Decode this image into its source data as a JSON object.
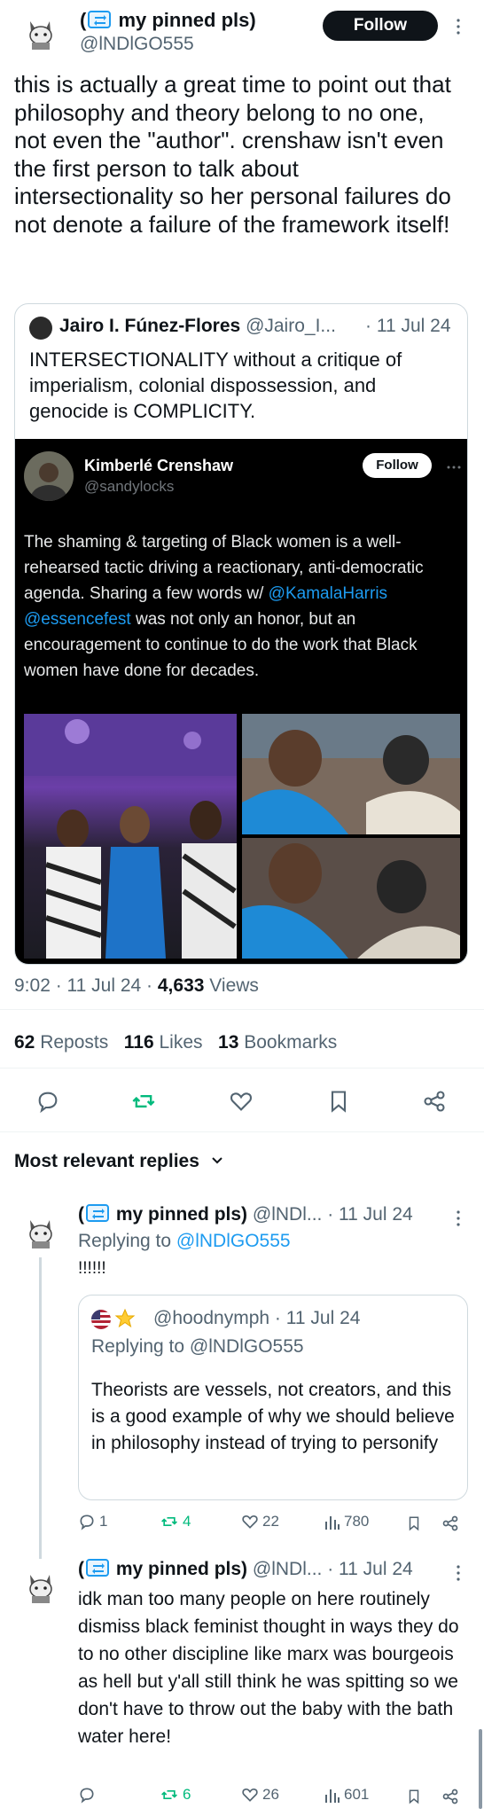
{
  "main_tweet": {
    "display_name": "my pinned pls)",
    "name_prefix": "(",
    "handle": "@lNDlGO555",
    "follow_label": "Follow",
    "text": "this is actually a great time to point out that philosophy and theory belong to no one, not even the \"author\". crenshaw isn't even the first person to talk about intersectionality so her personal failures do not denote a failure of the framework itself!",
    "timestamp": "9:02 · 11 Jul 24 · ",
    "views_count": "4,633",
    "views_label": " Views",
    "reposts_count": "62",
    "reposts_label": " Reposts",
    "likes_count": "116",
    "likes_label": " Likes",
    "bookmarks_count": "13",
    "bookmarks_label": " Bookmarks"
  },
  "quoted_tweet": {
    "display_name": "Jairo I. Fúnez-Flores",
    "handle": "@Jairo_I...",
    "date": "· 11 Jul 24",
    "text": "INTERSECTIONALITY without a critique of imperialism, colonial dispossession, and genocide is COMPLICITY.",
    "embed": {
      "display_name": "Kimberlé Crenshaw",
      "handle": "@sandylocks",
      "follow_label": "Follow",
      "text_before": "The shaming & targeting of Black women is a well-rehearsed tactic driving a reactionary, anti-democratic agenda. Sharing a few words w/ ",
      "mention1": "@KamalaHarris",
      "mention2": "@essencefest",
      "text_after": " was not only an honor, but an encouragement to continue to do the work that Black women have done for decades."
    }
  },
  "replies_header": {
    "label": "Most relevant replies"
  },
  "reply1": {
    "name_prefix": "(",
    "display_name": "my pinned pls)",
    "handle": "@lNDl...",
    "date": "· 11 Jul 24",
    "replying_to_label": "Replying to ",
    "replying_to_handle": "@lNDlGO555",
    "text": "!!!!!!",
    "quote": {
      "handle": "@hoodnymph",
      "date": "· 11 Jul 24",
      "replying_to_label": "Replying to @lNDlGO555",
      "text": "Theorists are vessels, not creators, and this is a good example of why we should believe in philosophy instead of trying to personify"
    },
    "stats": {
      "replies": "1",
      "reposts": "4",
      "likes": "22",
      "views": "780"
    }
  },
  "reply2": {
    "name_prefix": "(",
    "display_name": "my pinned pls)",
    "handle": "@lNDl...",
    "date": "· 11 Jul 24",
    "text": "idk man too many people on here routinely dismiss black feminist thought in ways they do to no other discipline like marx was bourgeois as hell but y'all still think he was spitting so we don't have to throw out the baby with the bath water here!",
    "stats": {
      "replies": "",
      "reposts": "6",
      "likes": "26",
      "views": "601"
    }
  },
  "colors": {
    "accent": "#1d9bf0",
    "repost_green": "#00ba7c",
    "text": "#0f1419",
    "muted": "#536471",
    "border": "#cfd9de"
  }
}
